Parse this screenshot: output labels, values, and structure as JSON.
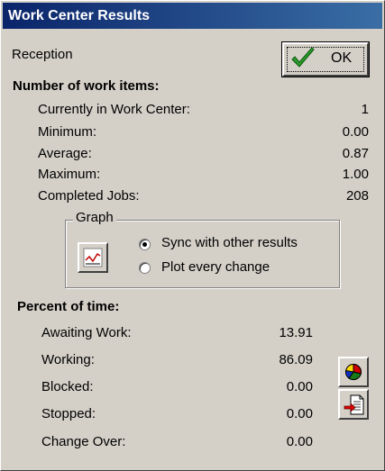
{
  "window": {
    "title": "Work Center Results"
  },
  "work_center_name": "Reception",
  "ok_button": {
    "label": "OK",
    "icon": "checkmark-icon"
  },
  "work_items": {
    "heading": "Number of work items:",
    "rows": [
      {
        "label": "Currently in Work Center:",
        "value": "1"
      },
      {
        "label": "Minimum:",
        "value": "0.00"
      },
      {
        "label": "Average:",
        "value": "0.87"
      },
      {
        "label": "Maximum:",
        "value": "1.00"
      },
      {
        "label": "Completed Jobs:",
        "value": "208"
      }
    ]
  },
  "graph": {
    "legend": "Graph",
    "button_icon": "line-chart-icon",
    "options": [
      {
        "label": "Sync with other results",
        "selected": true
      },
      {
        "label": "Plot every change",
        "selected": false
      }
    ]
  },
  "percent_time": {
    "heading": "Percent of time:",
    "rows": [
      {
        "label": "Awaiting Work:",
        "value": "13.91"
      },
      {
        "label": "Working:",
        "value": "86.09"
      },
      {
        "label": "Blocked:",
        "value": "0.00"
      },
      {
        "label": "Stopped:",
        "value": "0.00"
      },
      {
        "label": "Change Over:",
        "value": "0.00"
      }
    ]
  },
  "side_buttons": [
    {
      "icon": "pie-chart-icon"
    },
    {
      "icon": "export-document-icon"
    }
  ],
  "colors": {
    "title_bar": "#0a246a",
    "face": "#d4d0c8"
  }
}
